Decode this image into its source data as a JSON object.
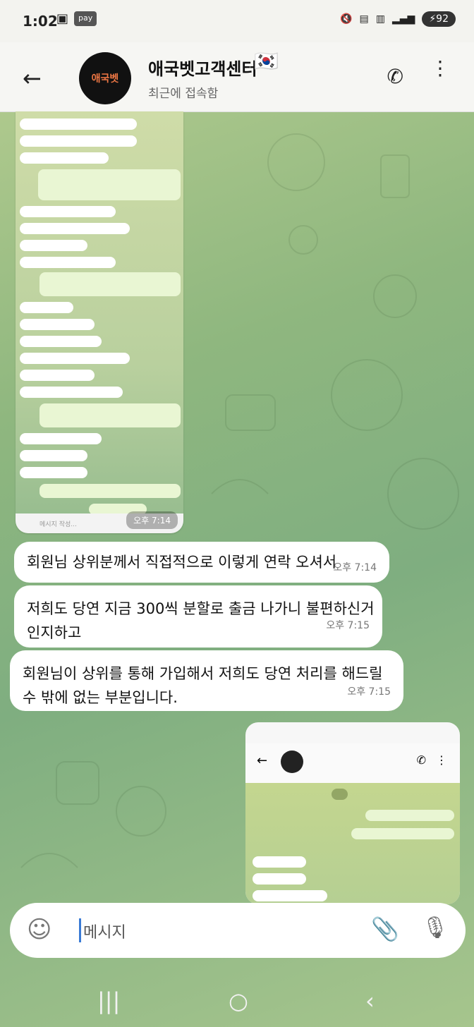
{
  "status_bar": {
    "time": "1:02",
    "battery": "92"
  },
  "header": {
    "title": "애국벳고객센터",
    "subtitle": "최근에 접속함",
    "avatar_text": "애국벳"
  },
  "embedded_screenshot_1": {
    "input_placeholder": "메시지 작성...",
    "overlay_time": "오후 7:14"
  },
  "messages": [
    {
      "text": "회원님 상위분께서 직접적으로 이렇게 연락 오셔서",
      "time": "오후 7:14"
    },
    {
      "text": "저희도 당연 지금 300씩 분할로 출금 나가니 불편하신거 인지하고",
      "time": "오후 7:15"
    },
    {
      "text": "회원님이 상위를 통해 가입해서 저희도 당연 처리를 해드릴수 밖에 없는 부분입니다.",
      "time": "오후 7:15"
    }
  ],
  "input_bar": {
    "placeholder": "메시지"
  },
  "colors": {
    "accent_cursor": "#3a7bd5",
    "bubble_bg": "#ffffff"
  }
}
